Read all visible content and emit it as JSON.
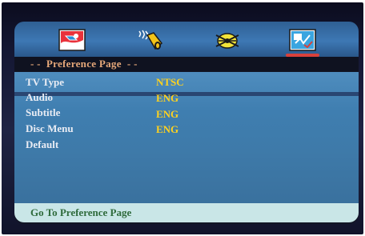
{
  "header": {
    "title": "- -  Preference Page  - -"
  },
  "tray_icons": [
    {
      "name": "general-setup-icon",
      "selected": false
    },
    {
      "name": "audio-setup-icon",
      "selected": false
    },
    {
      "name": "video-setup-icon",
      "selected": false
    },
    {
      "name": "preference-setup-icon",
      "selected": true
    }
  ],
  "menu": {
    "items": [
      {
        "label": "TV Type",
        "value": "NTSC"
      },
      {
        "label": "Audio",
        "value": "ENG"
      },
      {
        "label": "Subtitle",
        "value": "ENG"
      },
      {
        "label": "Disc Menu",
        "value": "ENG"
      },
      {
        "label": "Default",
        "value": ""
      }
    ]
  },
  "footer": {
    "hint": "Go To Preference Page"
  },
  "colors": {
    "header_text": "#e6a87a",
    "value_text": "#ffd21f",
    "label_text": "#e9ecf4",
    "footer_text": "#2f6b3c",
    "selected_marker": "#d8413b"
  }
}
